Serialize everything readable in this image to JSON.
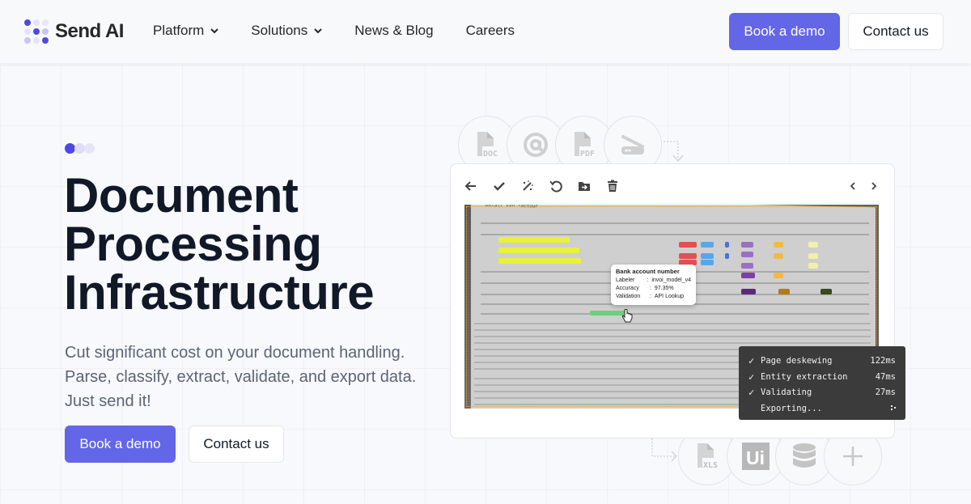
{
  "brand": {
    "name": "Send AI",
    "accent_color": "#6366e6"
  },
  "nav": {
    "items": [
      {
        "label": "Platform",
        "has_dropdown": true
      },
      {
        "label": "Solutions",
        "has_dropdown": true
      },
      {
        "label": "News & Blog",
        "has_dropdown": false
      },
      {
        "label": "Careers",
        "has_dropdown": false
      }
    ],
    "book_demo_label": "Book a demo",
    "contact_label": "Contact us"
  },
  "hero": {
    "title_lines": [
      "Document",
      "Processing",
      "Infrastructure"
    ],
    "subtitle_lines": [
      "Cut significant cost on your document handling.",
      "Parse, classify, extract, validate, and export data.",
      "Just send it!"
    ],
    "book_demo_label": "Book a demo",
    "contact_label": "Contact us"
  },
  "illustration": {
    "input_sources": [
      {
        "icon": "doc-file-icon",
        "label": "DOC"
      },
      {
        "icon": "at-sign-icon",
        "label": ""
      },
      {
        "icon": "pdf-file-icon",
        "label": "PDF"
      },
      {
        "icon": "scanner-icon",
        "label": ""
      }
    ],
    "output_targets": [
      {
        "icon": "xls-file-icon",
        "label": "XLS"
      },
      {
        "icon": "uipath-icon",
        "label": "Ui"
      },
      {
        "icon": "database-icon",
        "label": ""
      },
      {
        "icon": "plus-icon",
        "label": ""
      }
    ],
    "toolbar": [
      "back-arrow-icon",
      "check-icon",
      "magic-wand-icon",
      "undo-icon",
      "move-folder-icon",
      "trash-icon"
    ],
    "pager": [
      "chevron-left-icon",
      "chevron-right-icon"
    ],
    "document_header": "Detail van factuur",
    "tooltip": {
      "title": "Bank account number",
      "rows": [
        {
          "key": "Labeler",
          "value": "invoi_model_v4"
        },
        {
          "key": "Accuracy",
          "value": "97.35%"
        },
        {
          "key": "Validation",
          "value": "API Lookup"
        }
      ]
    },
    "status": [
      {
        "done": true,
        "label": "Page deskewing",
        "time": "122ms"
      },
      {
        "done": true,
        "label": "Entity extraction",
        "time": "47ms"
      },
      {
        "done": true,
        "label": "Validating",
        "time": "27ms"
      },
      {
        "done": false,
        "label": "Exporting...",
        "time": ""
      }
    ]
  }
}
